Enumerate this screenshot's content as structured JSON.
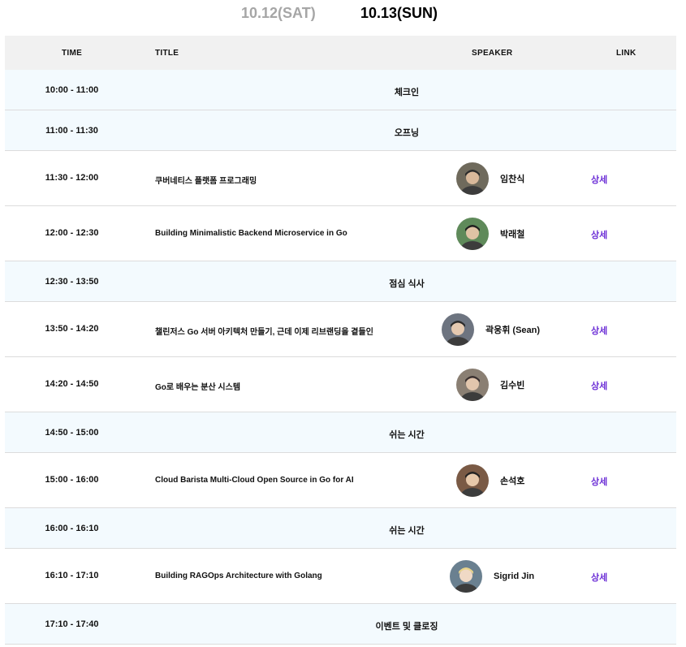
{
  "tabs": [
    {
      "label": "10.12(SAT)",
      "active": false
    },
    {
      "label": "10.13(SUN)",
      "active": true
    }
  ],
  "columns": {
    "time": "TIME",
    "title": "TITLE",
    "speaker": "SPEAKER",
    "link": "LINK"
  },
  "rows": [
    {
      "kind": "break",
      "time": "10:00 - 11:00",
      "title": "체크인"
    },
    {
      "kind": "break",
      "time": "11:00 - 11:30",
      "title": "오프닝"
    },
    {
      "kind": "talk",
      "time": "11:30 - 12:00",
      "title": "쿠버네티스 플랫폼 프로그래밍",
      "speaker": "임찬식",
      "link": "상세",
      "avatar": "speaker-photo-icon"
    },
    {
      "kind": "talk",
      "time": "12:00 - 12:30",
      "title": "Building Minimalistic Backend Microservice in Go",
      "speaker": "박래철",
      "link": "상세",
      "avatar": "speaker-photo-icon"
    },
    {
      "kind": "break",
      "time": "12:30 - 13:50",
      "title": "점심 식사"
    },
    {
      "kind": "talk",
      "time": "13:50 - 14:20",
      "title": "챌린저스 Go 서버 아키텍처 만들기, 근데 이제 리브랜딩을 곁들인",
      "speaker": "곽웅휘 (Sean)",
      "link": "상세",
      "avatar": "speaker-photo-icon"
    },
    {
      "kind": "talk",
      "time": "14:20 - 14:50",
      "title": "Go로 배우는 분산 시스템",
      "speaker": "김수빈",
      "link": "상세",
      "avatar": "speaker-photo-icon"
    },
    {
      "kind": "break",
      "time": "14:50 - 15:00",
      "title": "쉬는 시간"
    },
    {
      "kind": "talk",
      "time": "15:00 - 16:00",
      "title": "Cloud Barista Multi-Cloud Open Source in Go for AI",
      "speaker": "손석호",
      "link": "상세",
      "avatar": "speaker-photo-icon"
    },
    {
      "kind": "break",
      "time": "16:00 - 16:10",
      "title": "쉬는 시간"
    },
    {
      "kind": "talk",
      "time": "16:10 - 17:10",
      "title": "Building RAGOps Architecture with Golang",
      "speaker": "Sigrid Jin",
      "link": "상세",
      "avatar": "speaker-photo-icon"
    },
    {
      "kind": "break",
      "time": "17:10 - 17:40",
      "title": "이벤트 및 클로징"
    }
  ],
  "colors": {
    "break_bg": "#f3fafe",
    "header_bg": "#f1f1f1",
    "link": "#6b2dd6",
    "tab_inactive": "#a6a6a6"
  }
}
